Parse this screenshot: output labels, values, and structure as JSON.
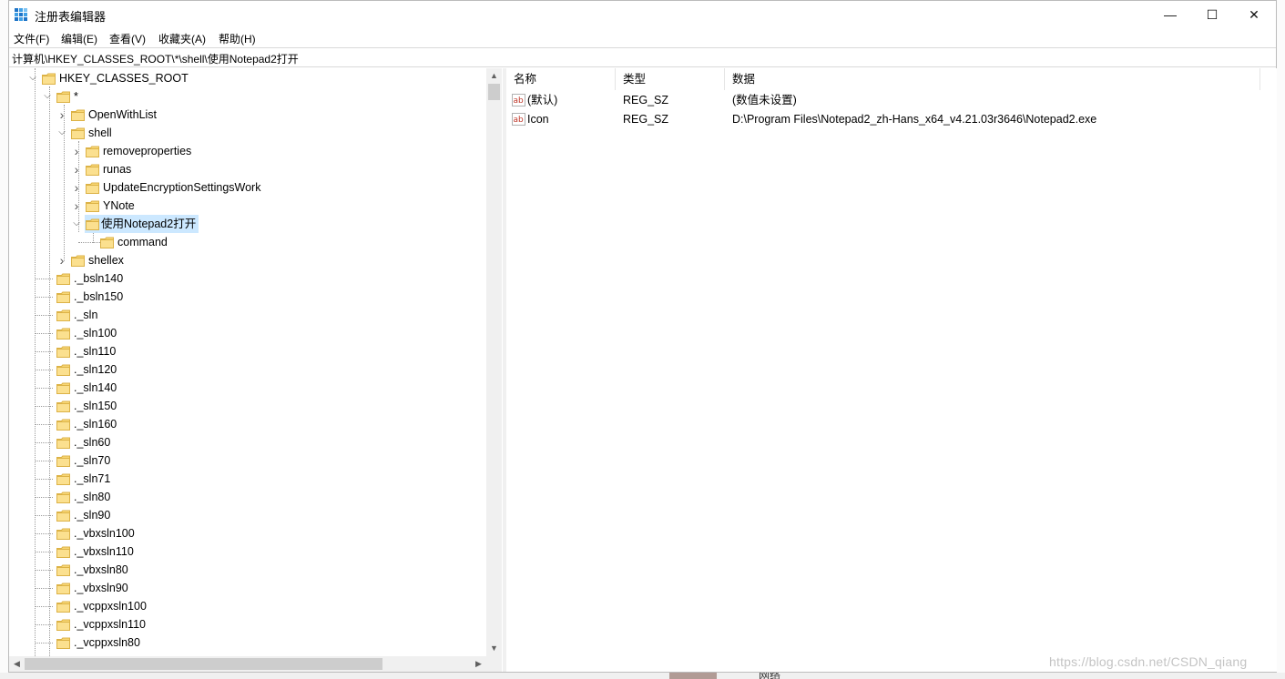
{
  "window": {
    "title": "注册表编辑器",
    "minimize_glyph": "—",
    "maximize_glyph": "☐",
    "close_glyph": "✕"
  },
  "menu": [
    "文件(F)",
    "编辑(E)",
    "查看(V)",
    "收藏夹(A)",
    "帮助(H)"
  ],
  "address": "计算机\\HKEY_CLASSES_ROOT\\*\\shell\\使用Notepad2打开",
  "tree": {
    "root": "HKEY_CLASSES_ROOT",
    "star": "*",
    "openwithlist": "OpenWithList",
    "shell": "shell",
    "removeproperties": "removeproperties",
    "runas": "runas",
    "updateenc": "UpdateEncryptionSettingsWork",
    "ynote": "YNote",
    "notepad2": "使用Notepad2打开",
    "command": "command",
    "shellex": "shellex",
    "siblings": [
      "._bsln140",
      "._bsln150",
      "._sln",
      "._sln100",
      "._sln110",
      "._sln120",
      "._sln140",
      "._sln150",
      "._sln160",
      "._sln60",
      "._sln70",
      "._sln71",
      "._sln80",
      "._sln90",
      "._vbxsln100",
      "._vbxsln110",
      "._vbxsln80",
      "._vbxsln90",
      "._vcppxsln100",
      "._vcppxsln110",
      "._vcppxsln80"
    ]
  },
  "list": {
    "columns": [
      "名称",
      "类型",
      "数据"
    ],
    "rows": [
      {
        "name": "(默认)",
        "type": "REG_SZ",
        "data": "(数值未设置)"
      },
      {
        "name": "Icon",
        "type": "REG_SZ",
        "data": "D:\\Program Files\\Notepad2_zh-Hans_x64_v4.21.03r3646\\Notepad2.exe"
      }
    ]
  },
  "watermark": "https://blog.csdn.net/CSDN_qiang",
  "background": {
    "taskbar_label": "网络"
  },
  "colors": {
    "selection": "#cce8ff",
    "folder": "#f8d775"
  }
}
